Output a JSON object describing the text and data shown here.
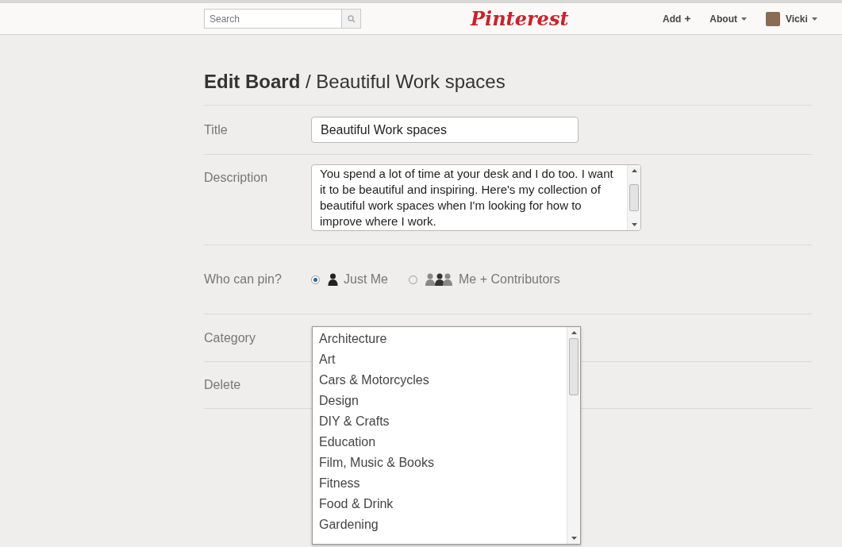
{
  "header": {
    "search": {
      "placeholder": "Search"
    },
    "logo": "Pinterest",
    "nav": [
      {
        "label": "Add",
        "kind": "plus"
      },
      {
        "label": "About",
        "kind": "menu"
      },
      {
        "label": "Vicki",
        "kind": "user"
      }
    ]
  },
  "page": {
    "title_bold": "Edit Board",
    "title_rest": "/ Beautiful Work spaces"
  },
  "form": {
    "title": {
      "label": "Title",
      "value": "Beautiful Work spaces"
    },
    "description": {
      "label": "Description",
      "value": "You spend a lot of time at your desk and I do too. I want it to be beautiful and inspiring. Here's my collection of beautiful work spaces when I'm looking for how to improve where I work."
    },
    "who_can_pin": {
      "label": "Who can pin?",
      "options": [
        {
          "label": "Just Me",
          "kind": "single",
          "selected": true
        },
        {
          "label": "Me + Contributors",
          "kind": "group",
          "selected": false
        }
      ]
    },
    "category": {
      "label": "Category",
      "options": [
        {
          "label": "Architecture",
          "selected": false
        },
        {
          "label": "Art",
          "selected": false
        },
        {
          "label": "Cars & Motorcycles",
          "selected": false
        },
        {
          "label": "Design",
          "selected": false
        },
        {
          "label": "DIY & Crafts",
          "selected": false
        },
        {
          "label": "Education",
          "selected": false
        },
        {
          "label": "Film, Music & Books",
          "selected": false
        },
        {
          "label": "Fitness",
          "selected": false
        },
        {
          "label": "Food & Drink",
          "selected": false
        },
        {
          "label": "Gardening",
          "selected": false
        }
      ]
    },
    "delete": {
      "label": "Delete"
    }
  }
}
